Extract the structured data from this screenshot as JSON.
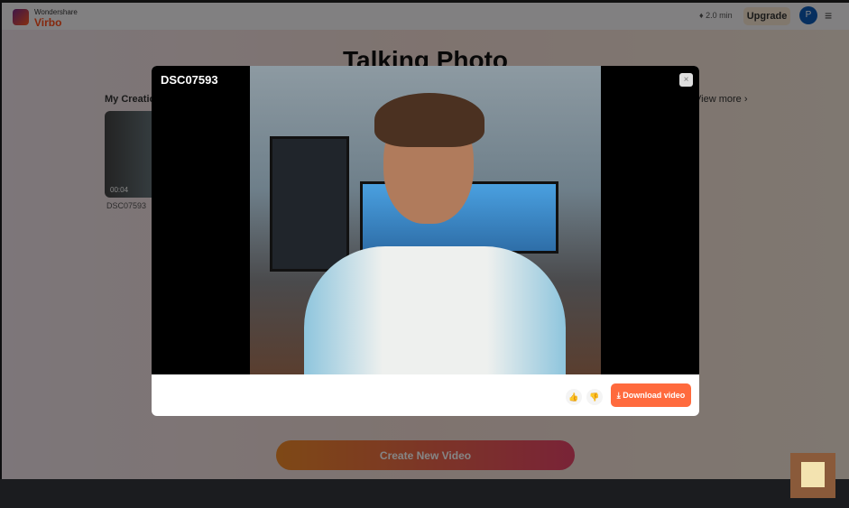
{
  "header": {
    "brand_top": "Wondershare",
    "brand_name": "Virbo",
    "credits": "2.0 min",
    "upgrade": "Upgrade",
    "avatar_initial": "P"
  },
  "page": {
    "title": "Talking Photo",
    "section": "My Creations",
    "view_more": "View more ›",
    "create_button": "Create New Video"
  },
  "creations": [
    {
      "name": "DSC07593",
      "duration": "00:04"
    }
  ],
  "modal": {
    "title": "DSC07593",
    "close": "×",
    "download": "⤓ Download video",
    "like": "👍",
    "dislike": "👎"
  },
  "colors": {
    "accent": "#ff6a3d",
    "avatar": "#0d5bb6"
  }
}
